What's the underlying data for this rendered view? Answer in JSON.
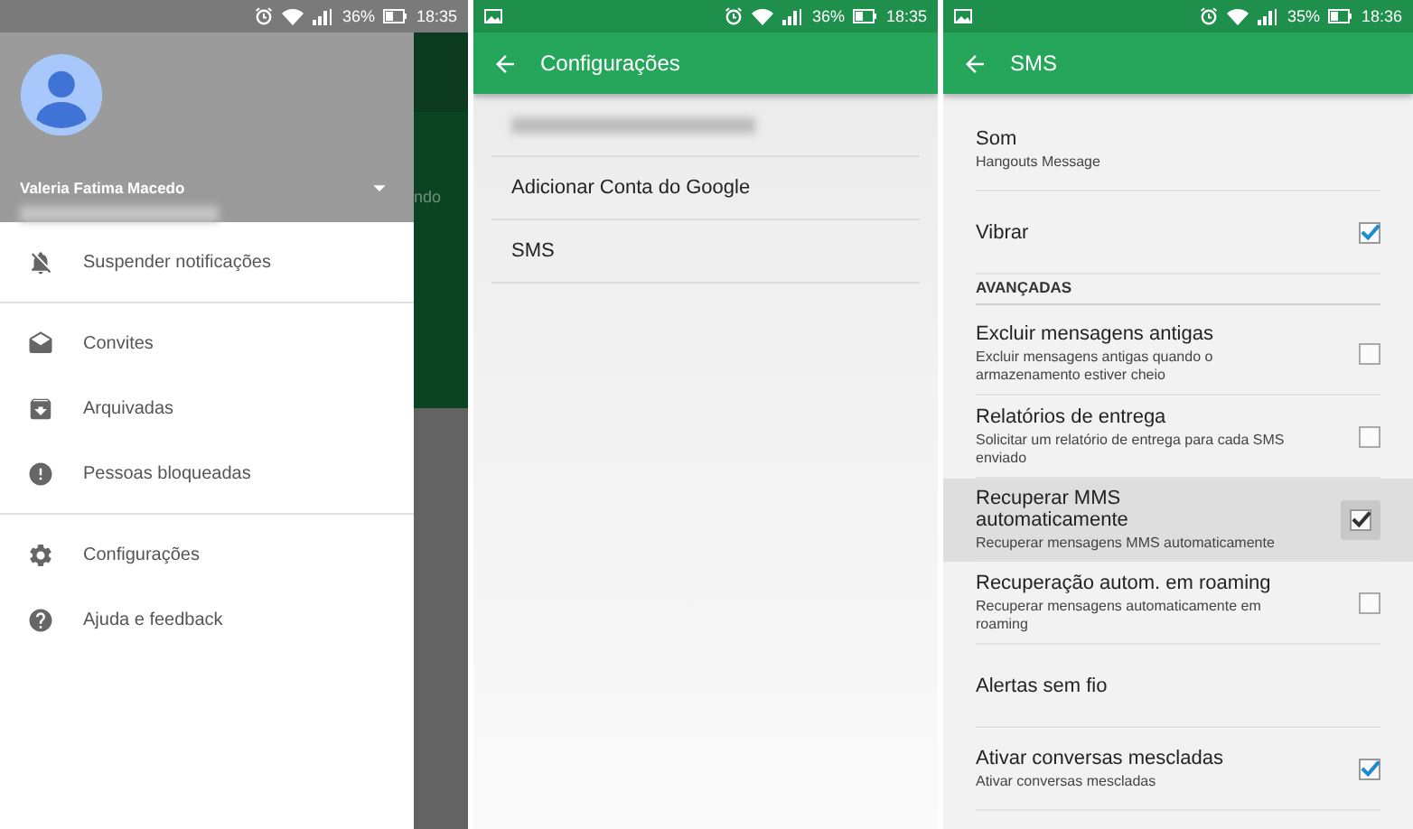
{
  "screens": [
    {
      "status_bar": {
        "battery": "36%",
        "time": "18:35"
      },
      "drawer": {
        "account": {
          "name": "Valeria Fatima Macedo"
        },
        "menu_groups": [
          [
            {
              "label": "Suspender notificações"
            }
          ],
          [
            {
              "label": "Convites"
            },
            {
              "label": "Arquivadas"
            },
            {
              "label": "Pessoas bloqueadas"
            }
          ],
          [
            {
              "label": "Configurações"
            },
            {
              "label": "Ajuda e feedback"
            }
          ]
        ]
      },
      "behind_text": "ndo"
    },
    {
      "status_bar": {
        "battery": "36%",
        "time": "18:35"
      },
      "toolbar": {
        "title": "Configurações"
      },
      "items": [
        {
          "kind": "blurred"
        },
        {
          "kind": "text",
          "label": "Adicionar Conta do Google"
        },
        {
          "kind": "text",
          "label": "SMS"
        }
      ]
    },
    {
      "status_bar": {
        "battery": "35%",
        "time": "18:36"
      },
      "toolbar": {
        "title": "SMS"
      },
      "settings": [
        {
          "kind": "plain",
          "title": "Som",
          "subtitle": "Hangouts Message",
          "pressed": false
        },
        {
          "kind": "checkbox",
          "title": "Vibrar",
          "checked": true,
          "pressed": false
        },
        {
          "kind": "header",
          "title": "AVANÇADAS"
        },
        {
          "kind": "checkbox",
          "title": "Excluir mensagens antigas",
          "subtitle": "Excluir mensagens antigas quando o armazenamento estiver cheio",
          "checked": false,
          "pressed": false
        },
        {
          "kind": "checkbox",
          "title": "Relatórios de entrega",
          "subtitle": "Solicitar um relatório de entrega para cada SMS enviado",
          "checked": false,
          "pressed": false
        },
        {
          "kind": "checkbox",
          "title": "Recuperar MMS automaticamente",
          "subtitle": "Recuperar mensagens MMS automaticamente",
          "checked": true,
          "pressed": true
        },
        {
          "kind": "checkbox",
          "title": "Recuperação autom. em roaming",
          "subtitle": "Recuperar mensagens automaticamente em roaming",
          "checked": false,
          "pressed": false
        },
        {
          "kind": "plain",
          "title": "Alertas sem fio",
          "pressed": false
        },
        {
          "kind": "checkbox",
          "title": "Ativar conversas mescladas",
          "subtitle": "Ativar conversas mescladas",
          "checked": true,
          "pressed": false
        }
      ]
    }
  ]
}
